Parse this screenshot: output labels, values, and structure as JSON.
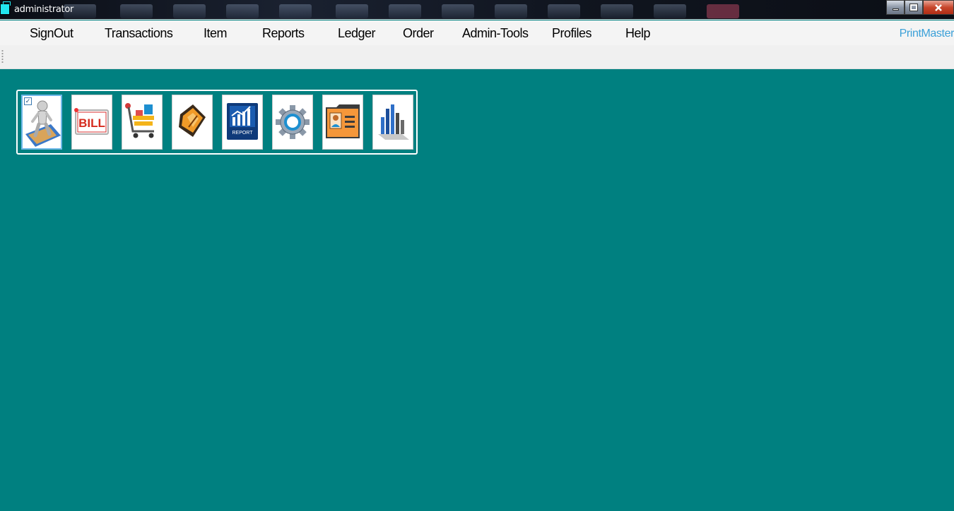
{
  "window": {
    "title": "administrator",
    "controls": {
      "minimize": "minimize",
      "maximize": "maximize",
      "close": "close"
    }
  },
  "menu": {
    "items": [
      {
        "label": "SignOut"
      },
      {
        "label": "Transactions"
      },
      {
        "label": "Item"
      },
      {
        "label": "Reports"
      },
      {
        "label": "Ledger"
      },
      {
        "label": "Order"
      },
      {
        "label": "Admin-Tools"
      },
      {
        "label": "Profiles"
      },
      {
        "label": "Help"
      }
    ],
    "brand": "PrintMaster"
  },
  "toolbar": {
    "buttons": [
      {
        "icon": "user-figure-icon",
        "selected": true
      },
      {
        "icon": "bill-icon",
        "text": "BILL"
      },
      {
        "icon": "shopping-cart-icon"
      },
      {
        "icon": "ledger-book-icon"
      },
      {
        "icon": "report-chart-icon",
        "text": "REPORT"
      },
      {
        "icon": "gear-settings-icon"
      },
      {
        "icon": "profile-folder-icon"
      },
      {
        "icon": "bar-chart-icon"
      }
    ]
  },
  "colors": {
    "desktop": "#008080",
    "brand": "#3ba0d8",
    "menu_bg": "#f4f4f4",
    "panel_border": "#ffffff"
  }
}
